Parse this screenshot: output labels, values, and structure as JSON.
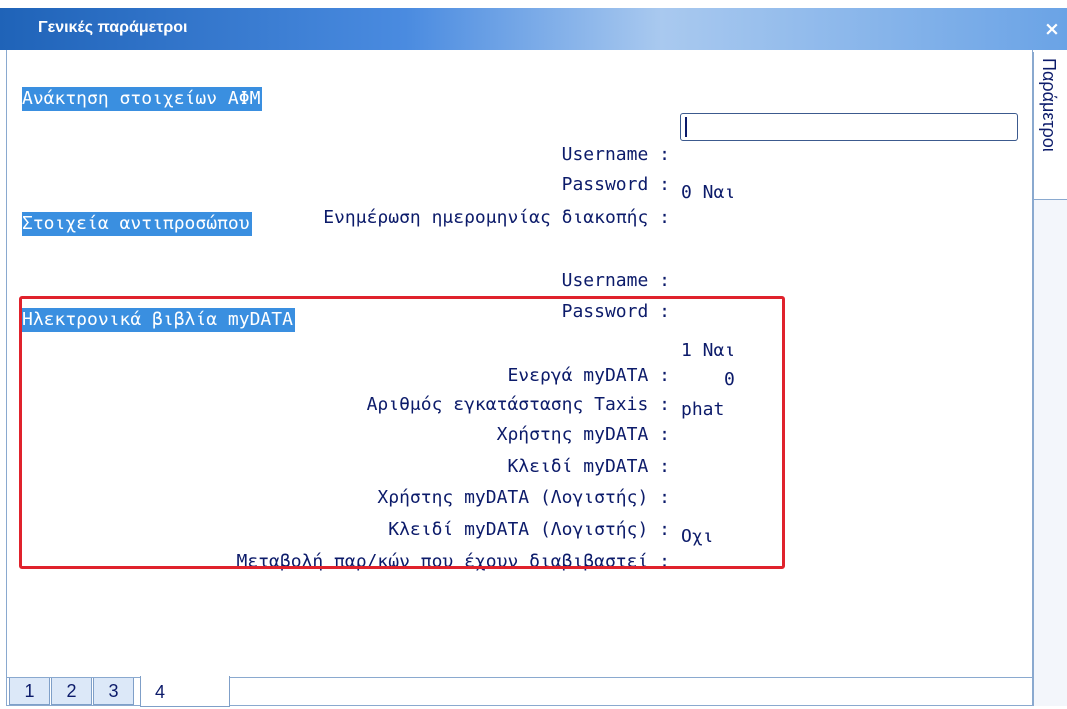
{
  "window": {
    "title": "Γενικές παράμετροι",
    "close_glyph": "×",
    "side_tab_label": "Παράμετροι"
  },
  "sections": {
    "afm": {
      "header": "Ανάκτηση στοιχείων ΑΦΜ",
      "username_label": "Username :",
      "username_value": "",
      "password_label": "Password :",
      "stop_date_label": "Ενημέρωση ημερομηνίας διακοπής :",
      "stop_date_value": "0 Ναι"
    },
    "representative": {
      "header": "Στοιχεία αντιπροσώπου",
      "username_label": "Username :",
      "password_label": "Password :"
    },
    "mydata": {
      "header": "Ηλεκτρονικά βιβλία myDATA",
      "active_label": "Ενεργά myDATA :",
      "active_value": "1 Ναι",
      "taxis_label": "Αριθμός εγκατάστασης Taxis :",
      "taxis_value": "0",
      "user_label": "Χρήστης myDATA :",
      "user_value": "phat",
      "key_label": "Κλειδί myDATA :",
      "acc_user_label": "Χρήστης myDATA (Λογιστής) :",
      "acc_key_label": "Κλειδί myDATA (Λογιστής) :",
      "change_label": "Μεταβολή παρ/κών που έχουν διαβιβαστεί :",
      "change_value": "Οχι"
    }
  },
  "tabs": [
    "1",
    "2",
    "3",
    "4"
  ],
  "active_tab": "4",
  "colors": {
    "accent_blue": "#3a8fe0",
    "text_navy": "#0c1b6a",
    "highlight_red": "#e0222c"
  }
}
